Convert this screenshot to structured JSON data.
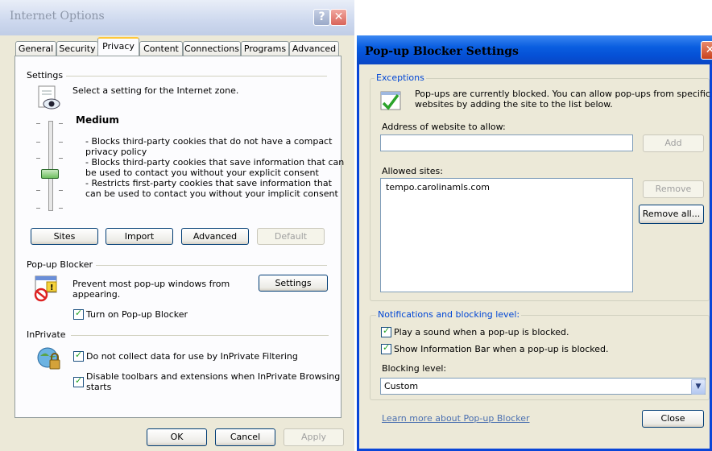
{
  "internet_options": {
    "title": "Internet Options",
    "help_glyph": "?",
    "close_glyph": "✕",
    "tabs": [
      "General",
      "Security",
      "Privacy",
      "Content",
      "Connections",
      "Programs",
      "Advanced"
    ],
    "active_tab": "Privacy",
    "settings": {
      "label": "Settings",
      "intro": "Select a setting for the Internet zone.",
      "level": "Medium",
      "lines": [
        "- Blocks third-party cookies that do not have a compact",
        "privacy policy",
        "- Blocks third-party cookies that save information that can",
        "be used to contact you without your explicit consent",
        "- Restricts first-party cookies that save information that",
        "can be used to contact you without your implicit consent"
      ],
      "buttons": {
        "sites": "Sites",
        "import": "Import",
        "advanced": "Advanced",
        "default": "Default"
      }
    },
    "popup_blocker": {
      "label": "Pop-up Blocker",
      "desc_line1": "Prevent most pop-up windows from",
      "desc_line2": "appearing.",
      "settings_button": "Settings",
      "turn_on_label": "Turn on Pop-up Blocker",
      "turn_on_checked": true
    },
    "inprivate": {
      "label": "InPrivate",
      "filter_label": "Do not collect data for use by InPrivate Filtering",
      "filter_checked": true,
      "toolbars_line1": "Disable toolbars and extensions when InPrivate Browsing",
      "toolbars_line2": "starts",
      "toolbars_checked": true
    },
    "footer": {
      "ok": "OK",
      "cancel": "Cancel",
      "apply": "Apply"
    }
  },
  "popup_settings": {
    "title": "Pop-up Blocker Settings",
    "close_glyph": "✕",
    "exceptions": {
      "legend": "Exceptions",
      "info_line1": "Pop-ups are currently blocked.  You can allow pop-ups from specific",
      "info_line2": "websites by adding the site to the list below.",
      "address_label": "Address of website to allow:",
      "address_value": "",
      "add_button": "Add",
      "allowed_label": "Allowed sites:",
      "allowed_sites": [
        "tempo.carolinamls.com"
      ],
      "remove_button": "Remove",
      "remove_all_button": "Remove all..."
    },
    "notifications": {
      "legend": "Notifications and blocking level:",
      "play_sound_label": "Play a sound when a pop-up is blocked.",
      "play_sound_checked": true,
      "info_bar_label": "Show Information Bar when a pop-up is blocked.",
      "info_bar_checked": true,
      "blocking_level_label": "Blocking level:",
      "blocking_level_value": "Custom"
    },
    "learn_more_link": "Learn more about Pop-up Blocker",
    "close_button": "Close"
  }
}
